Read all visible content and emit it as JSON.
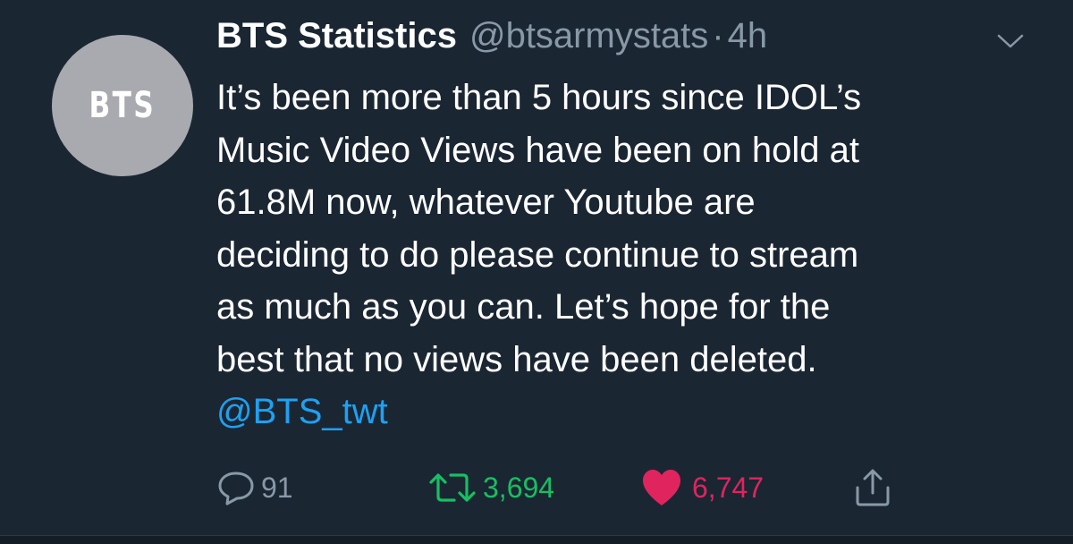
{
  "tweet": {
    "avatar_text": "BTS",
    "display_name": "BTS Statistics",
    "handle": "@btsarmystats",
    "separator": "·",
    "time": "4h",
    "body_lines": [
      "It’s been more than 5 hours since IDOL’s",
      "Music Video Views have been on hold at",
      "61.8M now, whatever Youtube are",
      "deciding to do please continue to stream",
      "as much as you can. Let’s hope for the",
      "best that no views have been deleted."
    ],
    "mention": "@BTS_twt"
  },
  "actions": {
    "reply_count": "91",
    "retweet_count": "3,694",
    "like_count": "6,747"
  },
  "icons": {
    "reply": "reply-icon",
    "retweet": "retweet-icon",
    "like": "heart-icon",
    "share": "share-icon",
    "more": "chevron-down-icon"
  },
  "colors": {
    "background": "#1b2633",
    "secondary_text": "#8899a6",
    "mention": "#1da1f2",
    "retweet": "#17bf63",
    "like": "#e0245e"
  }
}
